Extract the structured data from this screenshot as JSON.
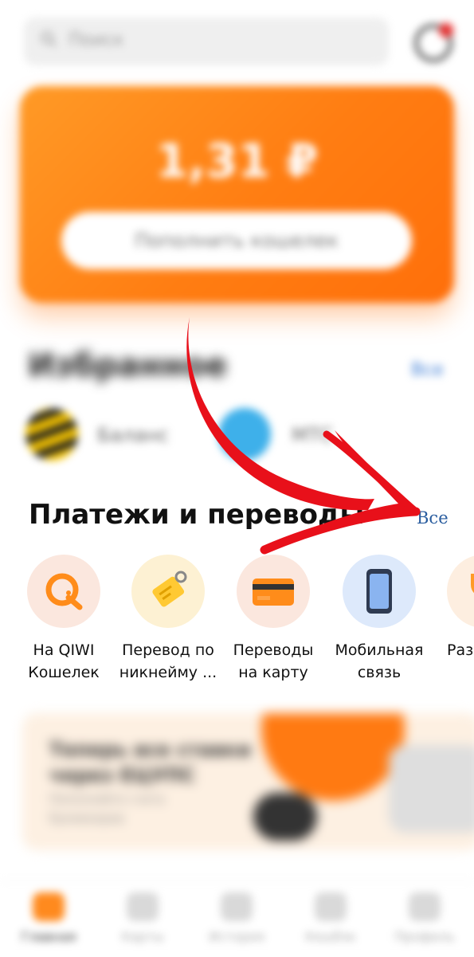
{
  "search": {
    "placeholder": "Поиск"
  },
  "wallet": {
    "balance": "1,31 ₽",
    "topup_label": "Пополнить кошелек"
  },
  "favorites": {
    "title": "Избранное",
    "all_label": "Все",
    "items": [
      {
        "label": "Баланс"
      },
      {
        "label": "МТС"
      }
    ]
  },
  "payments": {
    "title": "Платежи и переводы",
    "all_label": "Все",
    "items": [
      {
        "label": "На QIWI\nКошелек",
        "icon": "qiwi-icon",
        "bg": "#fbe7de"
      },
      {
        "label": "Перевод по\nникнейму ...",
        "icon": "tag-icon",
        "bg": "#fdf1d3"
      },
      {
        "label": "Переводы\nна карту",
        "icon": "card-icon",
        "bg": "#fbe7de"
      },
      {
        "label": "Мобильная\nсвязь",
        "icon": "phone-icon",
        "bg": "#dde9fb"
      },
      {
        "label": "Раз",
        "icon": "trophy-icon",
        "bg": "#fdeee0"
      }
    ]
  },
  "promo": {
    "title": "Теперь все ставки через ЕЦУПС",
    "subtitle": "Пополняйте счета букмекеров"
  },
  "bottom_nav": [
    {
      "label": "Главная",
      "icon": "home-icon"
    },
    {
      "label": "Карты",
      "icon": "cards-icon"
    },
    {
      "label": "История",
      "icon": "history-icon"
    },
    {
      "label": "Кешбэк",
      "icon": "cashback-icon"
    },
    {
      "label": "Профиль",
      "icon": "profile-icon"
    }
  ],
  "colors": {
    "accent": "#ff7d12",
    "link": "#2a5d9f",
    "arrow": "#e8101a"
  }
}
